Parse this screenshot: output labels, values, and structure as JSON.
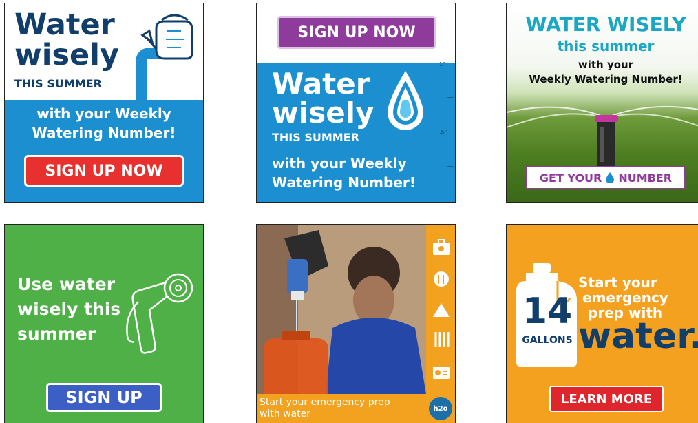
{
  "colors": {
    "navy": "#123e6b",
    "blue": "#1c8fd0",
    "red": "#e8312f",
    "purple": "#8e3b9c",
    "green": "#4fb048",
    "orange": "#f4a120",
    "teal": "#1aa7c3"
  },
  "ad1": {
    "headline_line1": "Water",
    "headline_line2": "wisely",
    "headline_line3": "THIS SUMMER",
    "subline1": "with your Weekly",
    "subline2": "Watering Number!",
    "button_label": "SIGN UP NOW",
    "icon": "watering-can-icon"
  },
  "ad2": {
    "button_label": "SIGN UP NOW",
    "headline_line1": "Water",
    "headline_line2": "wisely",
    "headline_line3": "THIS SUMMER",
    "subline1": "with your Weekly",
    "subline2": "Watering Number!",
    "ruler_labels": [
      "1\"",
      ".5\""
    ],
    "icon": "water-drop-icon"
  },
  "ad3": {
    "title_line1": "WATER WISELY",
    "title_line2": "this summer",
    "subline1": "with your",
    "subline2": "Weekly Watering Number!",
    "button_part1": "GET YOUR",
    "button_part2": "NUMBER",
    "icon": "sprinkler-icon"
  },
  "ad4": {
    "headline_line1": "Use water",
    "headline_line2": "wisely this",
    "headline_line3": "summer",
    "button_label": "SIGN UP",
    "icon": "hose-nozzle-icon"
  },
  "ad5": {
    "caption_line1": "Start your emergency prep",
    "caption_line2": "with water",
    "badge": "h2o",
    "side_icons": [
      "first-aid-icon",
      "food-icon",
      "tent-icon",
      "utensils-icon",
      "radio-icon"
    ]
  },
  "ad6": {
    "jug_number": "14",
    "jug_label": "GALLONS",
    "text_line1": "Start your",
    "text_line2": "emergency",
    "text_line3": "prep with",
    "text_big": "water.",
    "button_label": "LEARN MORE",
    "icon": "water-jug-icon"
  }
}
